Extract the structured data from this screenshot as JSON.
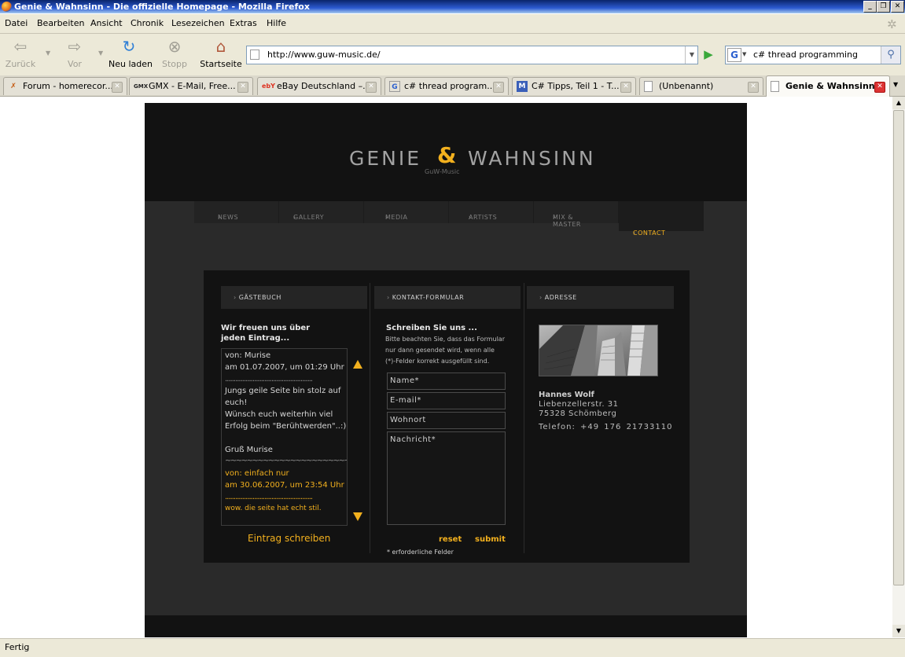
{
  "window": {
    "title": "Genie & Wahnsinn - Die offizielle Homepage - Mozilla Firefox"
  },
  "menu": [
    "Datei",
    "Bearbeiten",
    "Ansicht",
    "Chronik",
    "Lesezeichen",
    "Extras",
    "Hilfe"
  ],
  "toolbar": {
    "back": "Zurück",
    "forward": "Vor",
    "reload": "Neu laden",
    "stop": "Stopp",
    "home": "Startseite"
  },
  "address": {
    "url": "http://www.guw-music.de/"
  },
  "search": {
    "query": "c# thread programming",
    "engine_letter": "G"
  },
  "tabs": [
    {
      "title": "Forum - homerecor...",
      "icon": "X"
    },
    {
      "title": "GMX - E-Mail, Free...",
      "icon": "GMX"
    },
    {
      "title": "eBay Deutschland –...",
      "icon": "ebY"
    },
    {
      "title": "c# thread program...",
      "icon": "G"
    },
    {
      "title": "C# Tipps, Teil 1 - T...",
      "icon": "M"
    },
    {
      "title": "(Unbenannt)",
      "icon": ""
    },
    {
      "title": "Genie & Wahnsinn...",
      "icon": ""
    }
  ],
  "status": {
    "text": "Fertig"
  },
  "site": {
    "logo_left": "GENIE",
    "logo_amp": "&",
    "logo_right": "WAHNSINN",
    "logo_sub": "GuW-Music",
    "nav": [
      "NEWS",
      "GALLERY",
      "MEDIA",
      "ARTISTS",
      "MIX & MASTER",
      "CONTACT"
    ],
    "guestbook": {
      "heading": "GÄSTEBUCH",
      "intro_1": "Wir freuen uns über",
      "intro_2": "jeden Eintrag...",
      "lines": [
        "von: Murise",
        "am 01.07.2007, um 01:29 Uhr",
        "...................................................",
        "",
        "Jungs geile Seite bin stolz auf",
        "euch!",
        "Wünsch euch weiterhin viel",
        "Erfolg beim \"Berühtwerden\"..:)",
        "",
        "Gruß Murise",
        "~~~~~~~~~~~~~~~~~~~~~~~~~~~~~~",
        "von: einfach nur",
        "am 30.06.2007, um 23:54 Uhr",
        "...................................................",
        "wow. die seite hat echt stil."
      ],
      "write_link": "Eintrag schreiben"
    },
    "contact_form": {
      "heading": "KONTAKT-FORMULAR",
      "title": "Schreiben Sie uns ...",
      "note": [
        "Bitte beachten Sie, dass das Formular",
        "nur dann gesendet wird, wenn alle",
        "(*)-Felder korrekt ausgefüllt sind."
      ],
      "fields": [
        "Name*",
        "E-mail*",
        "Wohnort",
        "Nachricht*"
      ],
      "reset": "reset",
      "submit": "submit",
      "required_note": "* erforderliche Felder"
    },
    "address": {
      "heading": "ADRESSE",
      "name": "Hannes Wolf",
      "street": "Liebenzellerstr. 31",
      "city": "75328 Schömberg",
      "phone": "Telefon: +49 176 21733110"
    }
  }
}
